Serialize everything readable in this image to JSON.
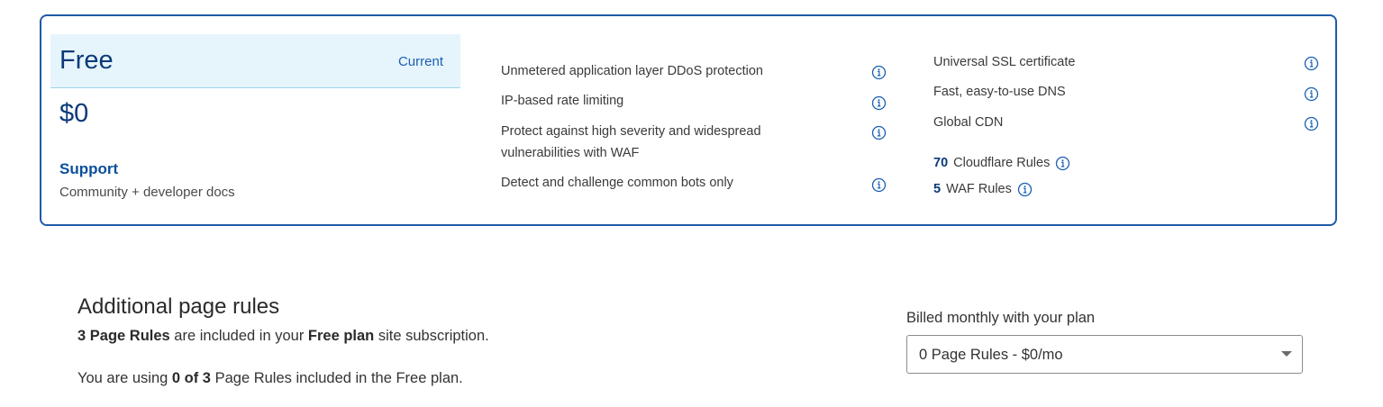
{
  "plan": {
    "name": "Free",
    "status": "Current",
    "price": "$0",
    "support_heading": "Support",
    "support_text": "Community + developer docs"
  },
  "features_left": [
    {
      "label": "Unmetered application layer DDoS protection",
      "icon": "info-icon"
    },
    {
      "label": "IP-based rate limiting",
      "icon": "info-icon"
    },
    {
      "label": "Protect against high severity and widespread vulnerabilities with WAF",
      "icon": "info-icon"
    },
    {
      "label": "Detect and challenge common bots only",
      "icon": "info-icon"
    }
  ],
  "features_right": [
    {
      "label": "Universal SSL certificate",
      "icon": "info-icon"
    },
    {
      "label": "Fast, easy-to-use DNS",
      "icon": "info-icon"
    },
    {
      "label": "Global CDN",
      "icon": "info-icon"
    }
  ],
  "rules": [
    {
      "count": "70",
      "label": "Cloudflare Rules",
      "icon": "info-icon"
    },
    {
      "count": "5",
      "label": "WAF Rules",
      "icon": "info-icon"
    }
  ],
  "additional": {
    "title": "Additional page rules",
    "included_count": "3 Page Rules",
    "included_mid": " are included in your ",
    "plan_name": "Free plan",
    "included_end": " site subscription.",
    "usage_start": "You are using ",
    "usage_count": "0 of 3",
    "usage_end": " Page Rules included in the Free plan."
  },
  "billing": {
    "label": "Billed monthly with your plan",
    "selected": "0 Page Rules - $0/mo"
  },
  "colors": {
    "card_border": "#1f5aa6",
    "header_bg": "#e6f5fb",
    "plan_text": "#0b3a7a",
    "link": "#1e5fb5",
    "icon": "#1a5fb4"
  }
}
